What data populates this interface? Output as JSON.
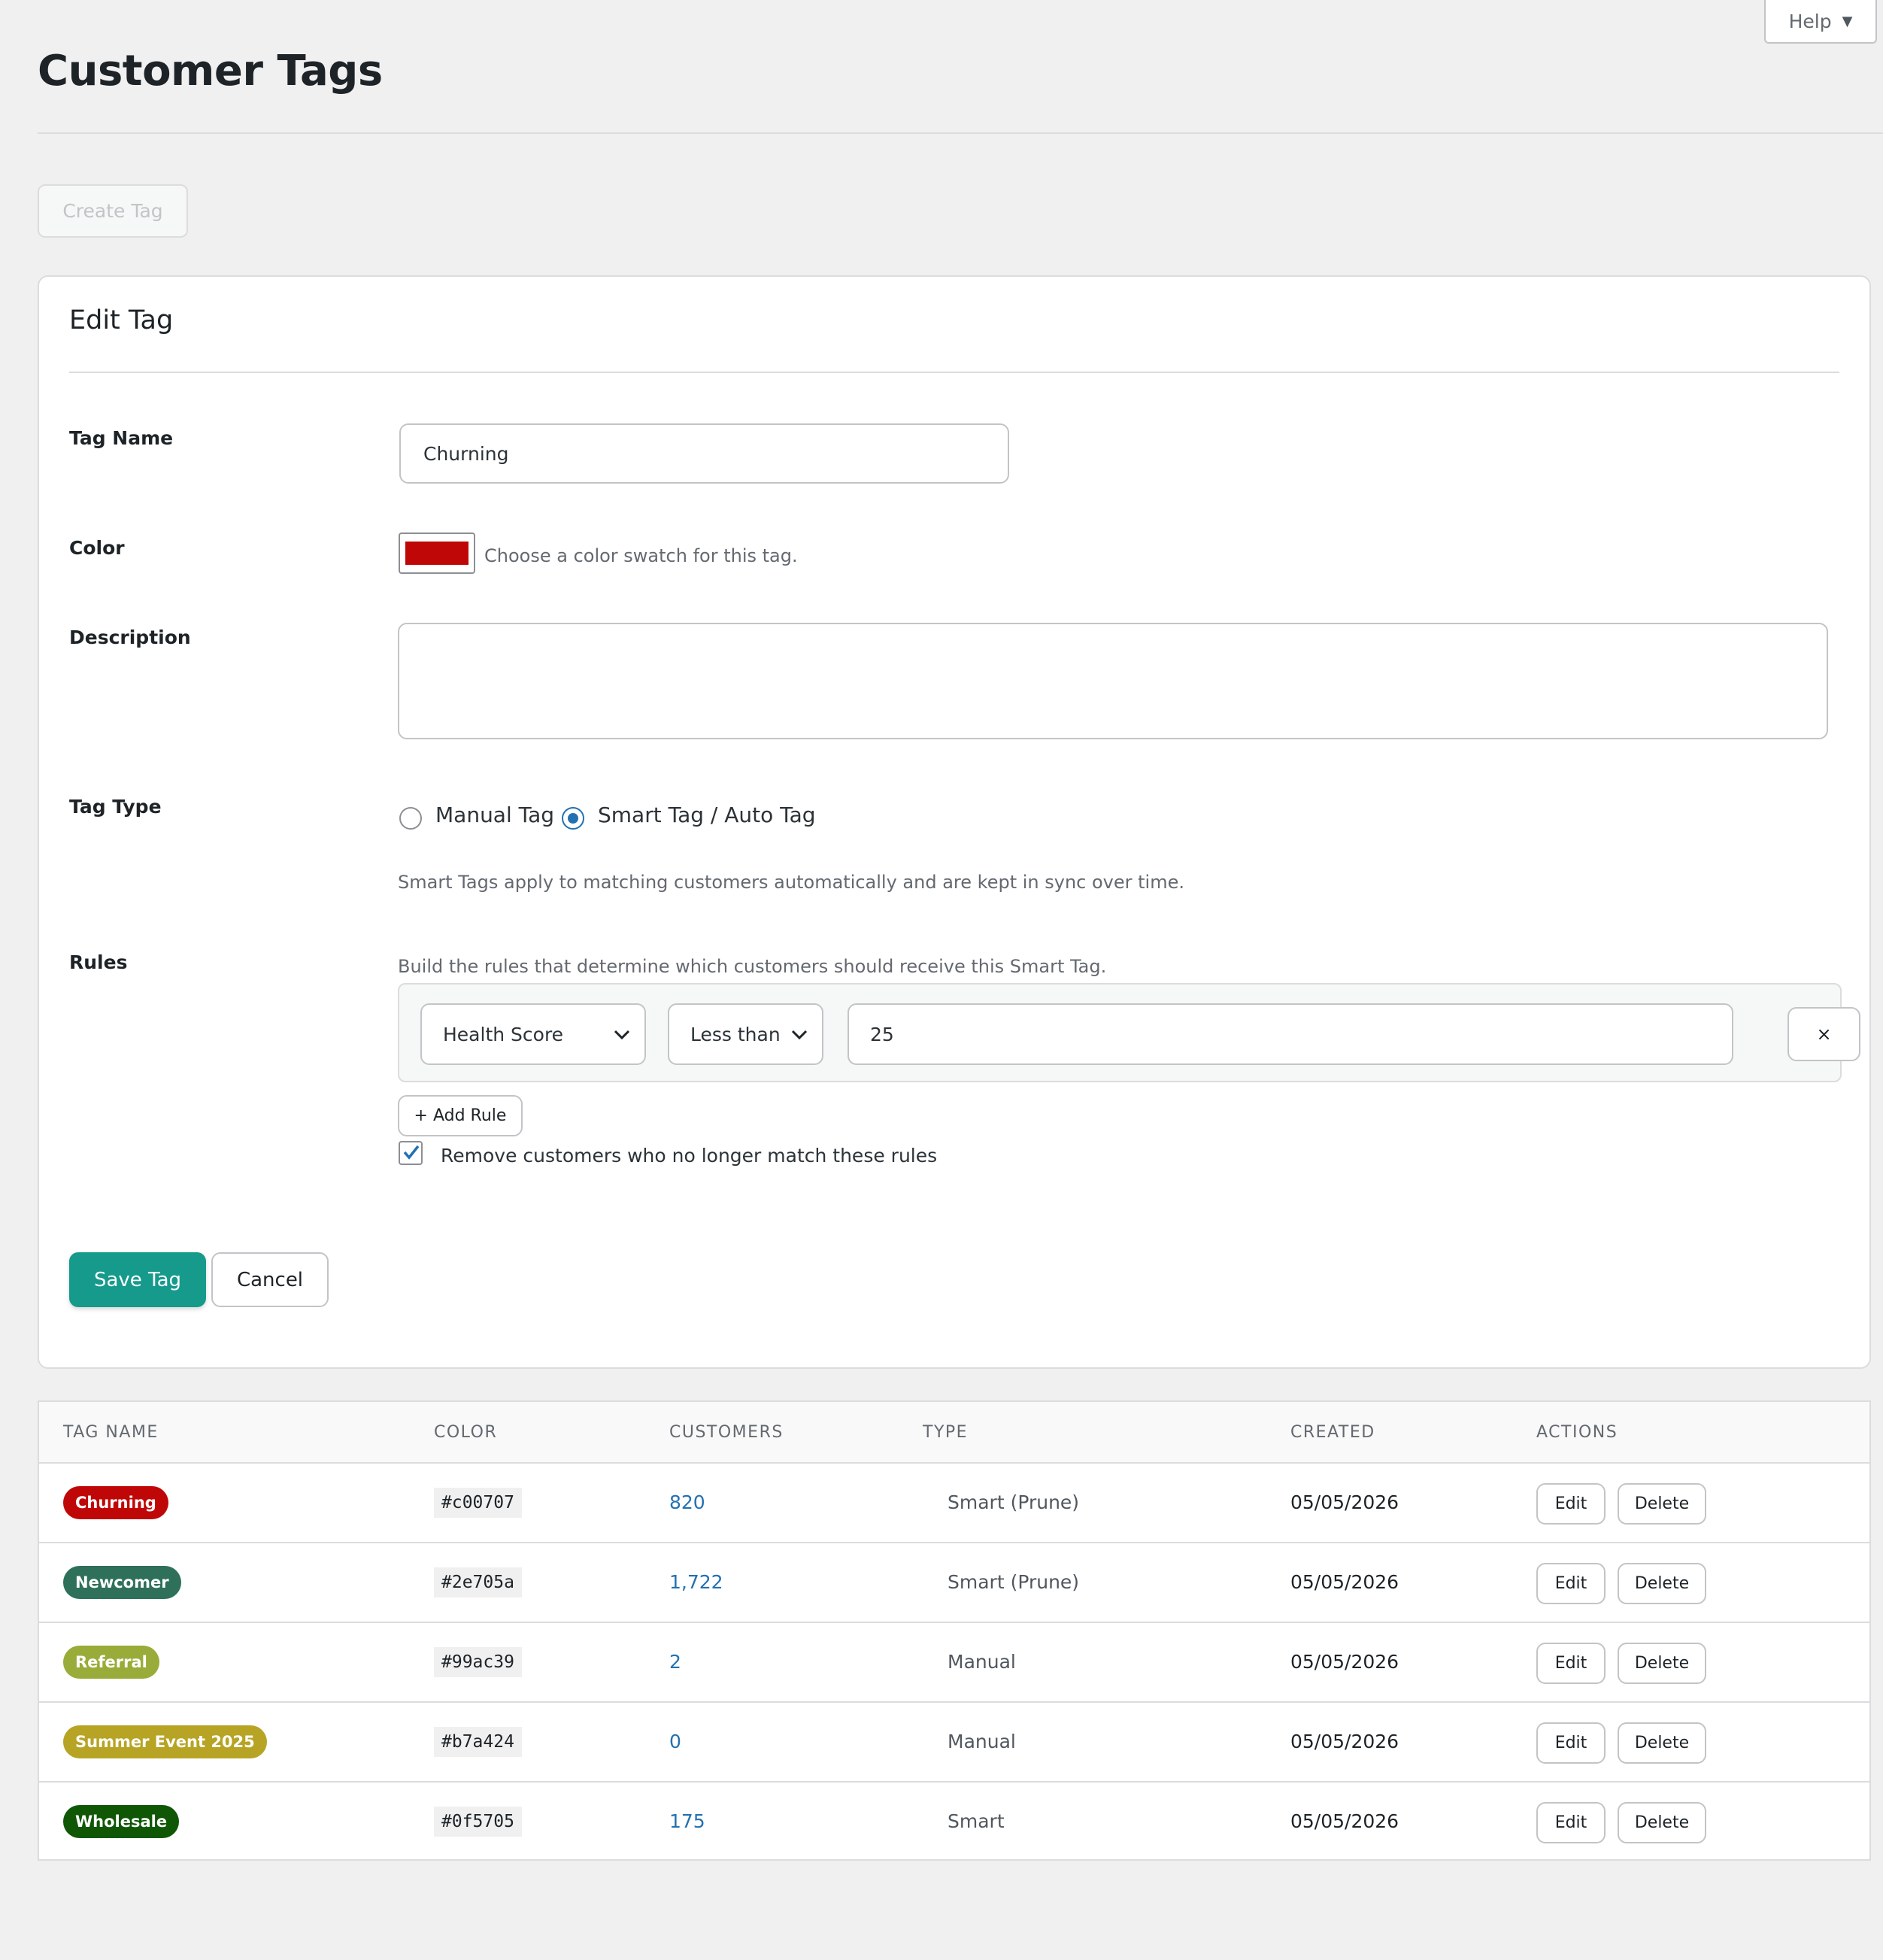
{
  "help": {
    "label": "Help"
  },
  "page": {
    "title": "Customer Tags"
  },
  "toolbar": {
    "create_label": "Create Tag"
  },
  "edit_panel": {
    "title": "Edit Tag",
    "tag_name": {
      "label": "Tag Name",
      "value": "Churning"
    },
    "color": {
      "label": "Color",
      "value": "#c00707",
      "help": "Choose a color swatch for this tag."
    },
    "description": {
      "label": "Description",
      "value": ""
    },
    "tag_type": {
      "label": "Tag Type",
      "options": [
        {
          "label": "Manual Tag",
          "selected": false
        },
        {
          "label": "Smart Tag / Auto Tag",
          "selected": true
        }
      ],
      "help": "Smart Tags apply to matching customers automatically and are kept in sync over time."
    },
    "rules": {
      "label": "Rules",
      "help": "Build the rules that determine which customers should receive this Smart Tag.",
      "items": [
        {
          "field": "Health Score",
          "operator": "Less than",
          "value": "25",
          "remove_label": "×"
        }
      ],
      "add_label": "+ Add Rule",
      "prune": {
        "checked": true,
        "label": "Remove customers who no longer match these rules"
      }
    },
    "save_label": "Save Tag",
    "cancel_label": "Cancel"
  },
  "table": {
    "columns": [
      "TAG NAME",
      "COLOR",
      "CUSTOMERS",
      "TYPE",
      "CREATED",
      "ACTIONS"
    ],
    "rows": [
      {
        "name": "Churning",
        "color": "#c00707",
        "customers": "820",
        "type": "Smart (Prune)",
        "created": "05/05/2026",
        "edit_label": "Edit",
        "delete_label": "Delete"
      },
      {
        "name": "Newcomer",
        "color": "#2e705a",
        "customers": "1,722",
        "type": "Smart (Prune)",
        "created": "05/05/2026",
        "edit_label": "Edit",
        "delete_label": "Delete"
      },
      {
        "name": "Referral",
        "color": "#99ac39",
        "customers": "2",
        "type": "Manual",
        "created": "05/05/2026",
        "edit_label": "Edit",
        "delete_label": "Delete"
      },
      {
        "name": "Summer Event 2025",
        "color": "#b7a424",
        "customers": "0",
        "type": "Manual",
        "created": "05/05/2026",
        "edit_label": "Edit",
        "delete_label": "Delete"
      },
      {
        "name": "Wholesale",
        "color": "#0f5705",
        "customers": "175",
        "type": "Smart",
        "created": "05/05/2026",
        "edit_label": "Edit",
        "delete_label": "Delete"
      }
    ]
  }
}
